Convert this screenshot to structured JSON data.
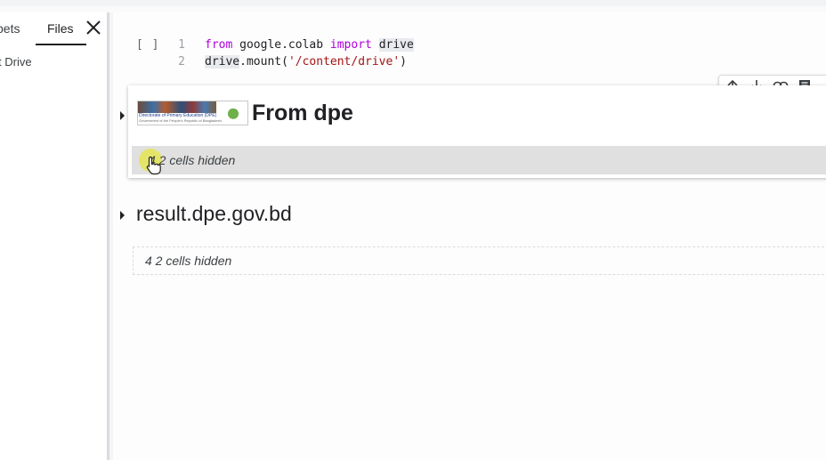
{
  "sidepanel": {
    "tabs": [
      {
        "label": "Code snippets",
        "visible_label": "pets"
      },
      {
        "label": "Files"
      }
    ],
    "drive_item": "t Drive"
  },
  "code_cell": {
    "run_bracket": "[ ]",
    "lines": [
      {
        "number": "1",
        "tokens": [
          "from",
          " google.colab ",
          "import",
          " ",
          "drive"
        ]
      },
      {
        "number": "2",
        "tokens": [
          "drive",
          ".mount(",
          "'/content/drive'",
          ")"
        ]
      }
    ]
  },
  "toolbar": {
    "icons": [
      "arrow-up-icon",
      "arrow-down-icon",
      "link-icon",
      "comment-icon",
      "edit-icon"
    ]
  },
  "section1": {
    "banner_title": "Directorate of Primary Education (DPE)",
    "banner_subtitle": "Government of the People's Republic of Bangladesh",
    "heading": "From dpe",
    "hidden_cells": "4 2 cells hidden"
  },
  "section2": {
    "heading": "result.dpe.gov.bd",
    "hidden_cells": "4 2 cells hidden"
  },
  "colors": {
    "keyword": "#af00db",
    "string": "#a31515",
    "cursor_highlight": "#e6e628"
  }
}
